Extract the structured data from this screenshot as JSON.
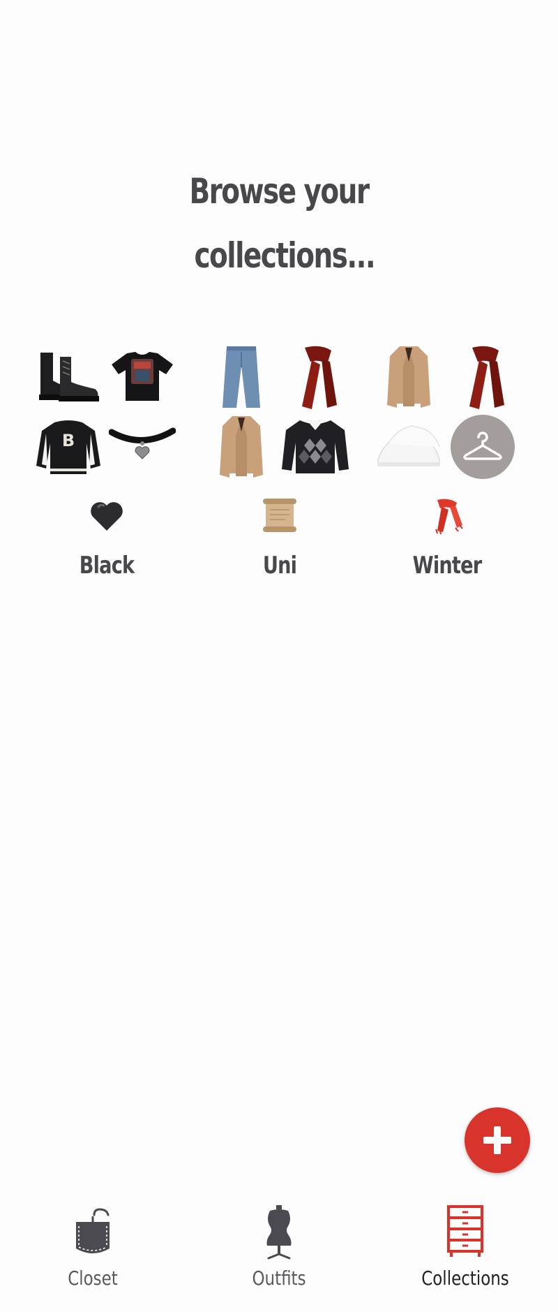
{
  "heading": {
    "line1": "Browse your",
    "line2": "collections..."
  },
  "collections": [
    {
      "name": "Black",
      "emoji": "black-heart",
      "items": [
        "combat-boots",
        "graphic-tee",
        "varsity-jacket",
        "heart-choker"
      ]
    },
    {
      "name": "Uni",
      "emoji": "scroll",
      "items": [
        "blue-jeans",
        "red-scarf",
        "camel-coat",
        "argyle-sweater"
      ]
    },
    {
      "name": "Winter",
      "emoji": "scarf",
      "items": [
        "camel-coat",
        "red-scarf",
        "white-sneakers",
        "hanger-placeholder"
      ]
    }
  ],
  "fab": {
    "icon": "plus-icon",
    "color": "#d9342b"
  },
  "nav": {
    "active_color": "#d9342b",
    "items": [
      {
        "label": "Closet",
        "icon": "pocket-icon",
        "active": false
      },
      {
        "label": "Outfits",
        "icon": "dress-form-icon",
        "active": false
      },
      {
        "label": "Collections",
        "icon": "drawers-icon",
        "active": true
      }
    ]
  }
}
